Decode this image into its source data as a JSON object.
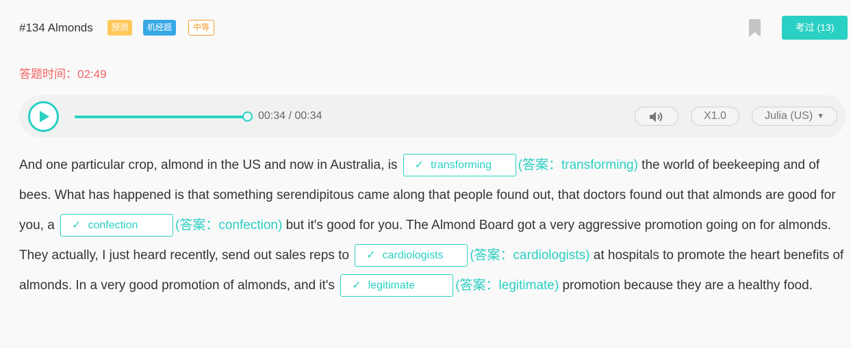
{
  "header": {
    "title": "#134 Almonds",
    "tags": {
      "predict": "预测",
      "jijing": "机经题",
      "level": "中等"
    },
    "passed_button": "考过 (13)"
  },
  "timer": "答题时间：02:49",
  "player": {
    "time_display": "00:34 / 00:34",
    "progress": 1.0,
    "speed": "X1.0",
    "voice": "Julia (US)"
  },
  "passage": {
    "p1": "And one particular crop, almond in the US and now in Australia, is ",
    "p2": " the world of beekeeping and of bees. What has happened is that something serendipitous came along that people found out, that doctors found out that almonds are good for you, a ",
    "p3": " but it's good for you. The Almond Board got a very aggressive promotion going on for almonds. They actually, I just heard recently, send out sales reps to ",
    "p4": " at hospitals to promote the heart benefits of almonds. In a very good promotion of almonds, and it's ",
    "p5": " promotion because they are a healthy food.",
    "check_mark": "✓",
    "blanks": [
      {
        "value": "transforming",
        "answer": "(答案：transforming)"
      },
      {
        "value": "confection",
        "answer": "(答案：confection)"
      },
      {
        "value": "cardiologists",
        "answer": "(答案：cardiologists)"
      },
      {
        "value": "legitimate",
        "answer": "(答案：legitimate)"
      }
    ]
  },
  "colors": {
    "accent": "#2ad0c3",
    "timer": "#f06262"
  },
  "icons": [
    "bookmark-icon",
    "play-icon",
    "volume-icon",
    "caret-down-icon",
    "check-icon"
  ]
}
